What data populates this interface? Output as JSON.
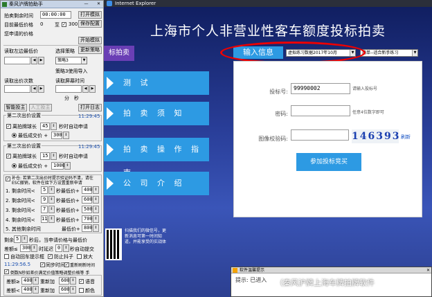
{
  "browser": {
    "window_title": "Internet Explorer"
  },
  "site": {
    "title": "上海市个人非营业性客车额度投标拍卖",
    "header_tab": "标拍卖",
    "nav": [
      {
        "label": "测 试"
      },
      {
        "label": "拍 卖 须 知"
      },
      {
        "label": "拍 卖 操 作 指 南"
      },
      {
        "label": "公 司 介 绍"
      }
    ],
    "qr_text": "扫描我们的微信号，更新消息可第一时间知道，并能享受的实战体"
  },
  "input_panel": {
    "tab_label": "输入信息",
    "select_practice": "虚拟练习数据2017年10月",
    "select_mode": "简单--适合新手练习",
    "bid_number_label": "投标号:",
    "bid_number_value": "99990002",
    "bid_number_hint": "请输入投标号",
    "password_label": "密码:",
    "password_value": "",
    "password_hint": "任意4位数字即可",
    "captcha_label": "图像校验码:",
    "captcha_value": "",
    "captcha_image_text": "146393",
    "refresh_label": "刷新",
    "submit_label": "参加投标竞买"
  },
  "message_dialog": {
    "title": "软件温馨提示",
    "body": "提示: 已进入",
    "watermark": "（秦风沪牌上海车牌拍牌软件"
  },
  "helper": {
    "title": "秦风沪牌拍助手",
    "remaining_label": "拍卖剩余时间",
    "remaining_value": "00:00:00",
    "open_sim": "打开模拟",
    "current_price_label": "目前最低价格",
    "current_price_value": "0",
    "to_label": "至",
    "max_value": "300",
    "save_config": "保存配置",
    "your_price_label": "您申请的价格",
    "start_sim": "开始模拟",
    "read_left_label": "读取左边最低价",
    "policy_label": "选择策略",
    "update_policy": "更新策略",
    "policy_value": "策略3",
    "import_policy": "策略3使用导入",
    "read_bid_label": "读取出价次数",
    "read_screen_label": "读取屏幕时间",
    "minute": "分",
    "second": "秒",
    "smart_bid": "智能投主",
    "manual_bid": "人工投主",
    "open_log": "打开日志",
    "second_bid": {
      "title": "第二次出价设置",
      "time": "11:29:45",
      "auto_label": "离拍牌球长",
      "auto_value": "45",
      "auto_suffix": "秒时自动申请",
      "lowest_label": "最低成交价 +",
      "lowest_value": "300"
    },
    "third_bid": {
      "title": "第三次出价设置",
      "time": "11:29:45",
      "auto_label": "离拍牌球长",
      "auto_value": "15",
      "auto_suffix": "秒时自动申请",
      "lowest_label": "最低成交价 +",
      "lowest_value": "1000"
    },
    "supplement_note": "补仓: 若第二次出价时提示验证码不清，请在ESC撤销，软件在接下方设置重新申请",
    "rows": [
      {
        "label": "1. 剩余时间<",
        "sec": "5",
        "price_label": "秒最低价+",
        "price": "400"
      },
      {
        "label": "2. 剩余时间<",
        "sec": "9",
        "price_label": "秒最低价+",
        "price": "600"
      },
      {
        "label": "3. 剩余时间<",
        "sec": "7",
        "price_label": "秒最低价+",
        "price": "500"
      },
      {
        "label": "4. 剩余时间<",
        "sec": "11",
        "price_label": "秒最低价+",
        "price": "700"
      },
      {
        "label": "5. 其他剩余时间",
        "sec": "",
        "price_label": "最低价+",
        "price": "800"
      }
    ],
    "remaining_sec_label": "剩余",
    "remaining_sec_value": "5",
    "remaining_sec_suffix": "秒后，当申请价格与最低价",
    "diff_label": "差额≤",
    "diff_value": "300",
    "delay_label": "时延迟",
    "delay_value": "0",
    "delay_suffix": "秒自动提交",
    "auto_enter": "自动回车提示框",
    "anti_shake": "防止抖子",
    "zoom_in": "放大",
    "clock_value": "11:29:56.5",
    "sync_time": "同步时间",
    "refresh_page": "重新刷新时间",
    "countdown_note": "倒数N秒如差价满足价值策略调整价格等 手",
    "diff_rows": [
      {
        "label": "差额≥",
        "v1": "400",
        "mid": "重新加",
        "v2": "600"
      },
      {
        "label": "差额<",
        "v1": "400",
        "mid": "重新加",
        "v2": "600"
      }
    ],
    "voice_label": "语音",
    "color_label": "颜色"
  }
}
